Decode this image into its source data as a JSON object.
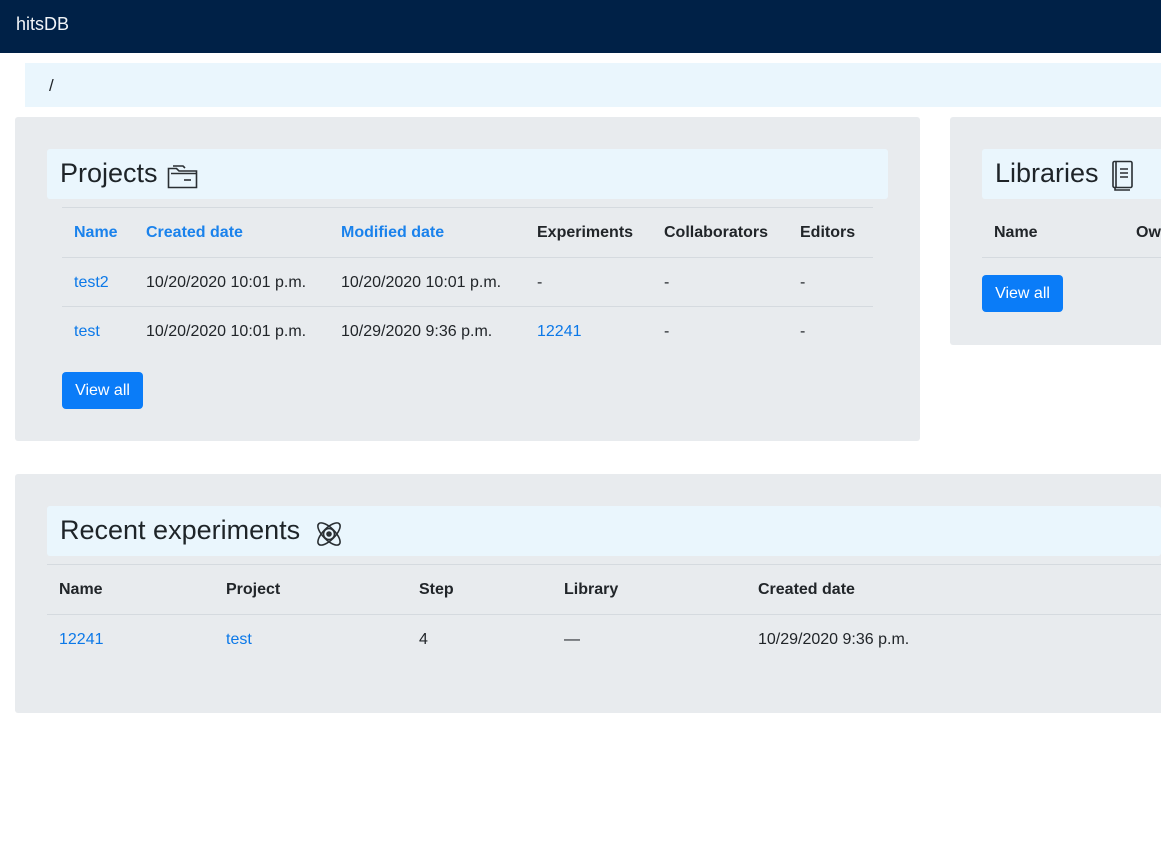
{
  "app": {
    "brand": "hitsDB"
  },
  "breadcrumb": {
    "text": "/"
  },
  "projects": {
    "title": "Projects",
    "icon": "folder-icon",
    "headers": [
      "Name",
      "Created date",
      "Modified date",
      "Experiments",
      "Collaborators",
      "Editors"
    ],
    "rows": [
      {
        "name": "test2",
        "created": "10/20/2020 10:01 p.m.",
        "modified": "10/20/2020 10:01 p.m.",
        "experiments": "-",
        "collaborators": "-",
        "editors": "-"
      },
      {
        "name": "test",
        "created": "10/20/2020 10:01 p.m.",
        "modified": "10/29/2020 9:36 p.m.",
        "experiments": "12241",
        "collaborators": "-",
        "editors": "-"
      }
    ],
    "view_all": "View all"
  },
  "libraries": {
    "title": "Libraries",
    "icon": "book-icon",
    "headers": [
      "Name",
      "Ow"
    ],
    "view_all": "View all"
  },
  "experiments": {
    "title": "Recent experiments",
    "icon": "atom-icon",
    "headers": [
      "Name",
      "Project",
      "Step",
      "Library",
      "Created date"
    ],
    "rows": [
      {
        "name": "12241",
        "project": "test",
        "step": "4",
        "library": "—",
        "created": "10/29/2020 9:36 p.m."
      }
    ]
  },
  "colors": {
    "navbar": "#002147",
    "accent": "#0a7cf8",
    "link": "#0b78e8",
    "panel": "#e8ebee",
    "title_bg": "#eaf6fd"
  }
}
